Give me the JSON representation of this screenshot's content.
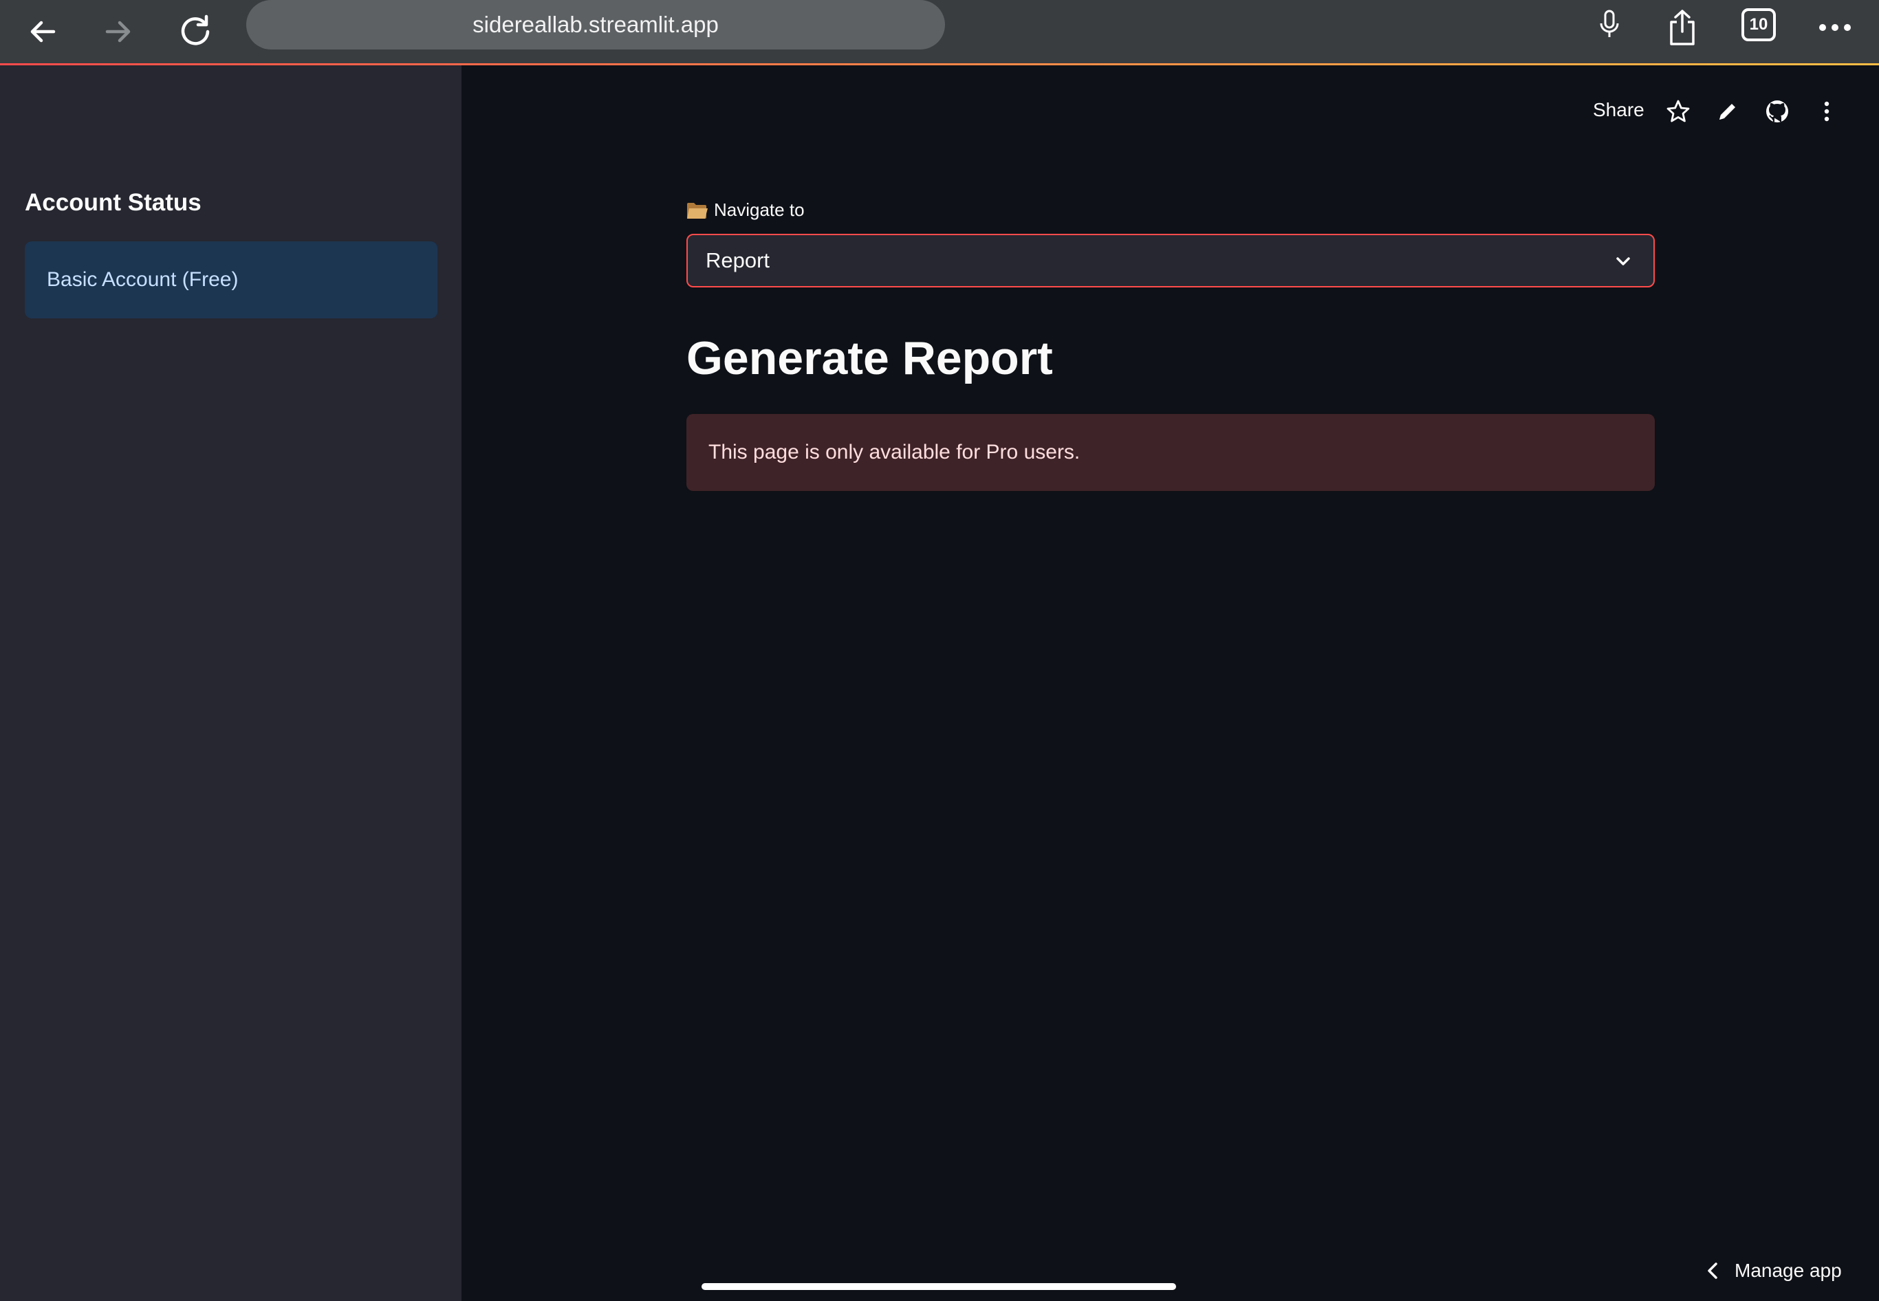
{
  "browser": {
    "url": "sidereallab.streamlit.app",
    "tab_count": "10",
    "icons": [
      "back-arrow-icon",
      "forward-arrow-icon",
      "reload-icon",
      "microphone-icon",
      "share-icon",
      "tabs-icon",
      "more-icon"
    ]
  },
  "header": {
    "share_label": "Share",
    "icons": [
      "star-icon",
      "pencil-icon",
      "github-icon",
      "vertical-dots-icon"
    ]
  },
  "sidebar": {
    "title": "Account Status",
    "status": "Basic Account (Free)"
  },
  "main": {
    "nav_label": "Navigate to",
    "nav_icon": "folder-icon",
    "select_value": "Report",
    "title": "Generate Report",
    "alert": "This page is only available for Pro users."
  },
  "footer": {
    "manage_label": "Manage app"
  },
  "colors": {
    "background": "#0e1117",
    "sidebar": "#262730",
    "accent": "#ff4b4b",
    "info_bg": "#1c3551",
    "error_bg": "#3e2328"
  }
}
